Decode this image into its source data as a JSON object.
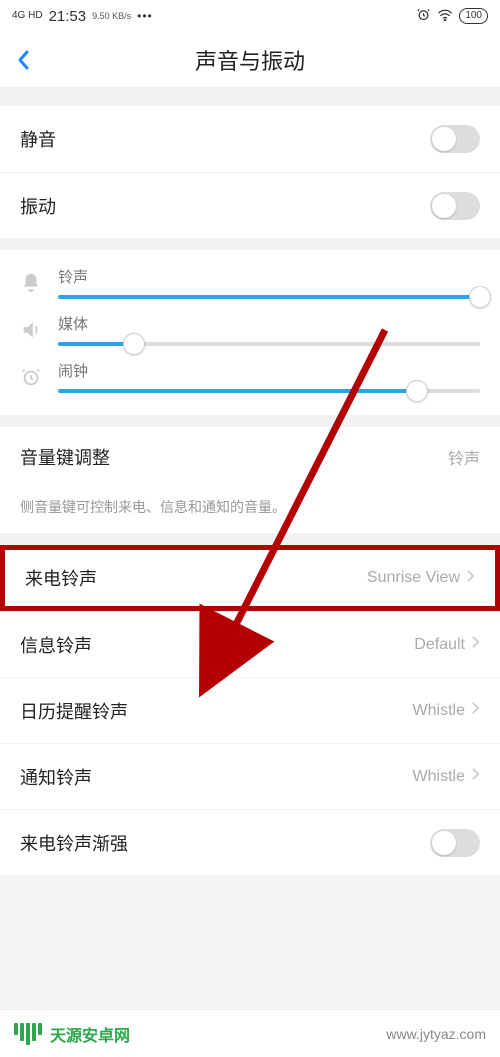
{
  "status": {
    "net": "4G HD",
    "time": "21:53",
    "kbs": "9.50 KB/s",
    "dots": "•••",
    "battery": "100"
  },
  "header": {
    "title": "声音与振动"
  },
  "toggles": {
    "mute_label": "静音",
    "vibrate_label": "振动"
  },
  "sliders": {
    "ringtone": {
      "label": "铃声",
      "value": 100
    },
    "media": {
      "label": "媒体",
      "value": 18
    },
    "alarm": {
      "label": "闹钟",
      "value": 85
    }
  },
  "volumekey": {
    "label": "音量键调整",
    "value": "铃声",
    "desc": "侧音量键可控制来电、信息和通知的音量。"
  },
  "sounds": {
    "incoming": {
      "label": "来电铃声",
      "value": "Sunrise View"
    },
    "sms": {
      "label": "信息铃声",
      "value": "Default"
    },
    "calendar": {
      "label": "日历提醒铃声",
      "value": "Whistle"
    },
    "notify": {
      "label": "通知铃声",
      "value": "Whistle"
    },
    "ascend": {
      "label": "来电铃声渐强"
    }
  },
  "watermark": {
    "brand": "天源安卓网",
    "url": "www.jytyaz.com"
  }
}
